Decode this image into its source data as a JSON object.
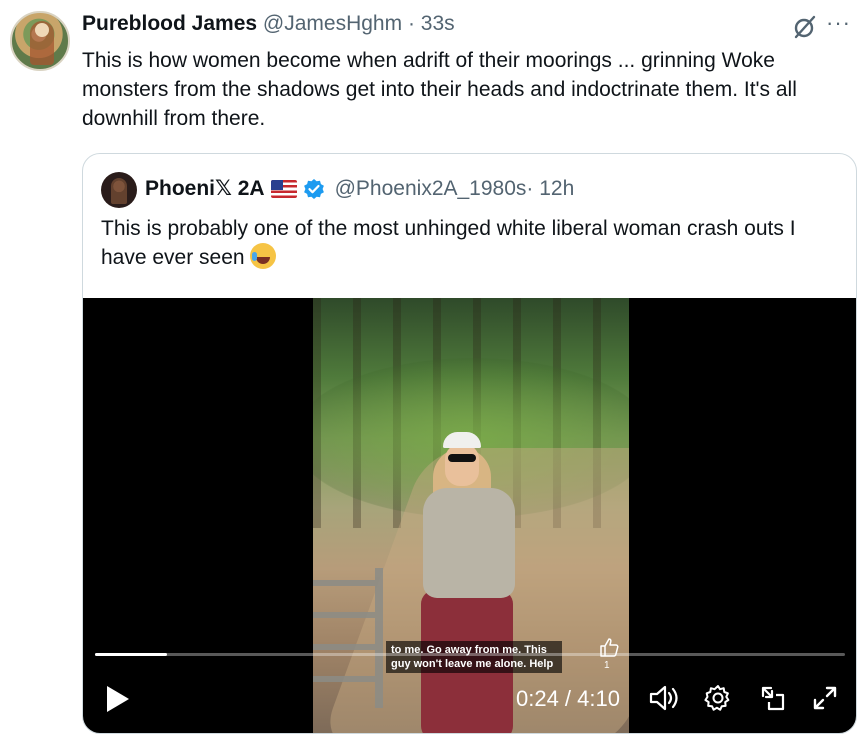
{
  "post": {
    "author_name": "Pureblood James",
    "author_handle": "@JamesHghm",
    "time": "· 33s",
    "text": "This is how women become when adrift of their moorings ... grinning Woke monsters from the shadows get into their heads and indoctrinate them. It's all downhill from there.",
    "more_label": "···"
  },
  "quote": {
    "author_name": "Phoeni𝕏 2A",
    "author_handle": "@Phoenix2A_1980s",
    "time": "· 12h",
    "text": "This is probably one of the most unhinged white liberal woman crash outs I have ever seen",
    "flag_icon": "us-flag-icon",
    "verified_color": "#1d9bf0"
  },
  "video": {
    "caption": "to me. Go away from me. This guy won't leave me alone. Help",
    "like_count": "1",
    "current_time": "0:24",
    "total_time": "4:10",
    "time_display": "0:24 / 4:10",
    "progress_fraction": 0.096
  }
}
